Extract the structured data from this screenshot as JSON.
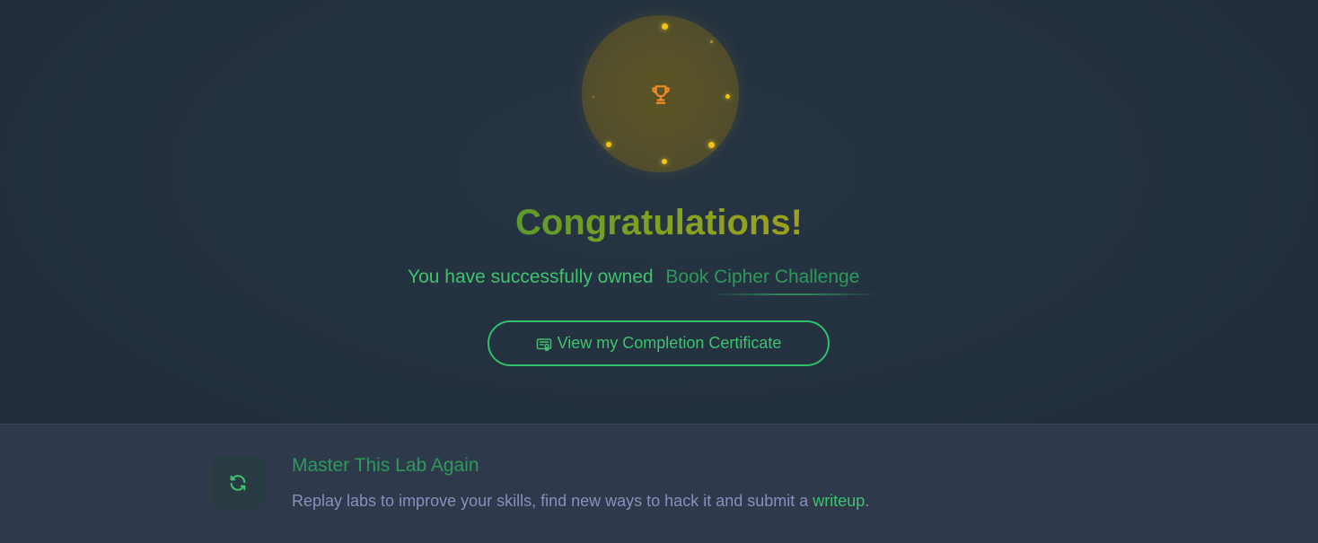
{
  "hero": {
    "icon": "trophy-icon",
    "title": "Congratulations!",
    "owned_prefix": "You have successfully owned",
    "lab_name": "Book Cipher Challenge",
    "cert_button": {
      "icon": "certificate-icon",
      "label": "View my Completion Certificate"
    }
  },
  "replay": {
    "icon": "refresh-icon",
    "title": "Master This Lab Again",
    "description_prefix": "Replay labs to improve your skills, find new ways to hack it and submit a ",
    "link_label": "writeup",
    "description_suffix": "."
  },
  "colors": {
    "accent_green": "#3ec46d",
    "dark_green": "#2d9a5a",
    "gold": "#f2c40f",
    "trophy_orange": "#f28c28",
    "background": "#263241",
    "panel": "#2e3a4b",
    "muted_text": "#8a8fbe"
  }
}
